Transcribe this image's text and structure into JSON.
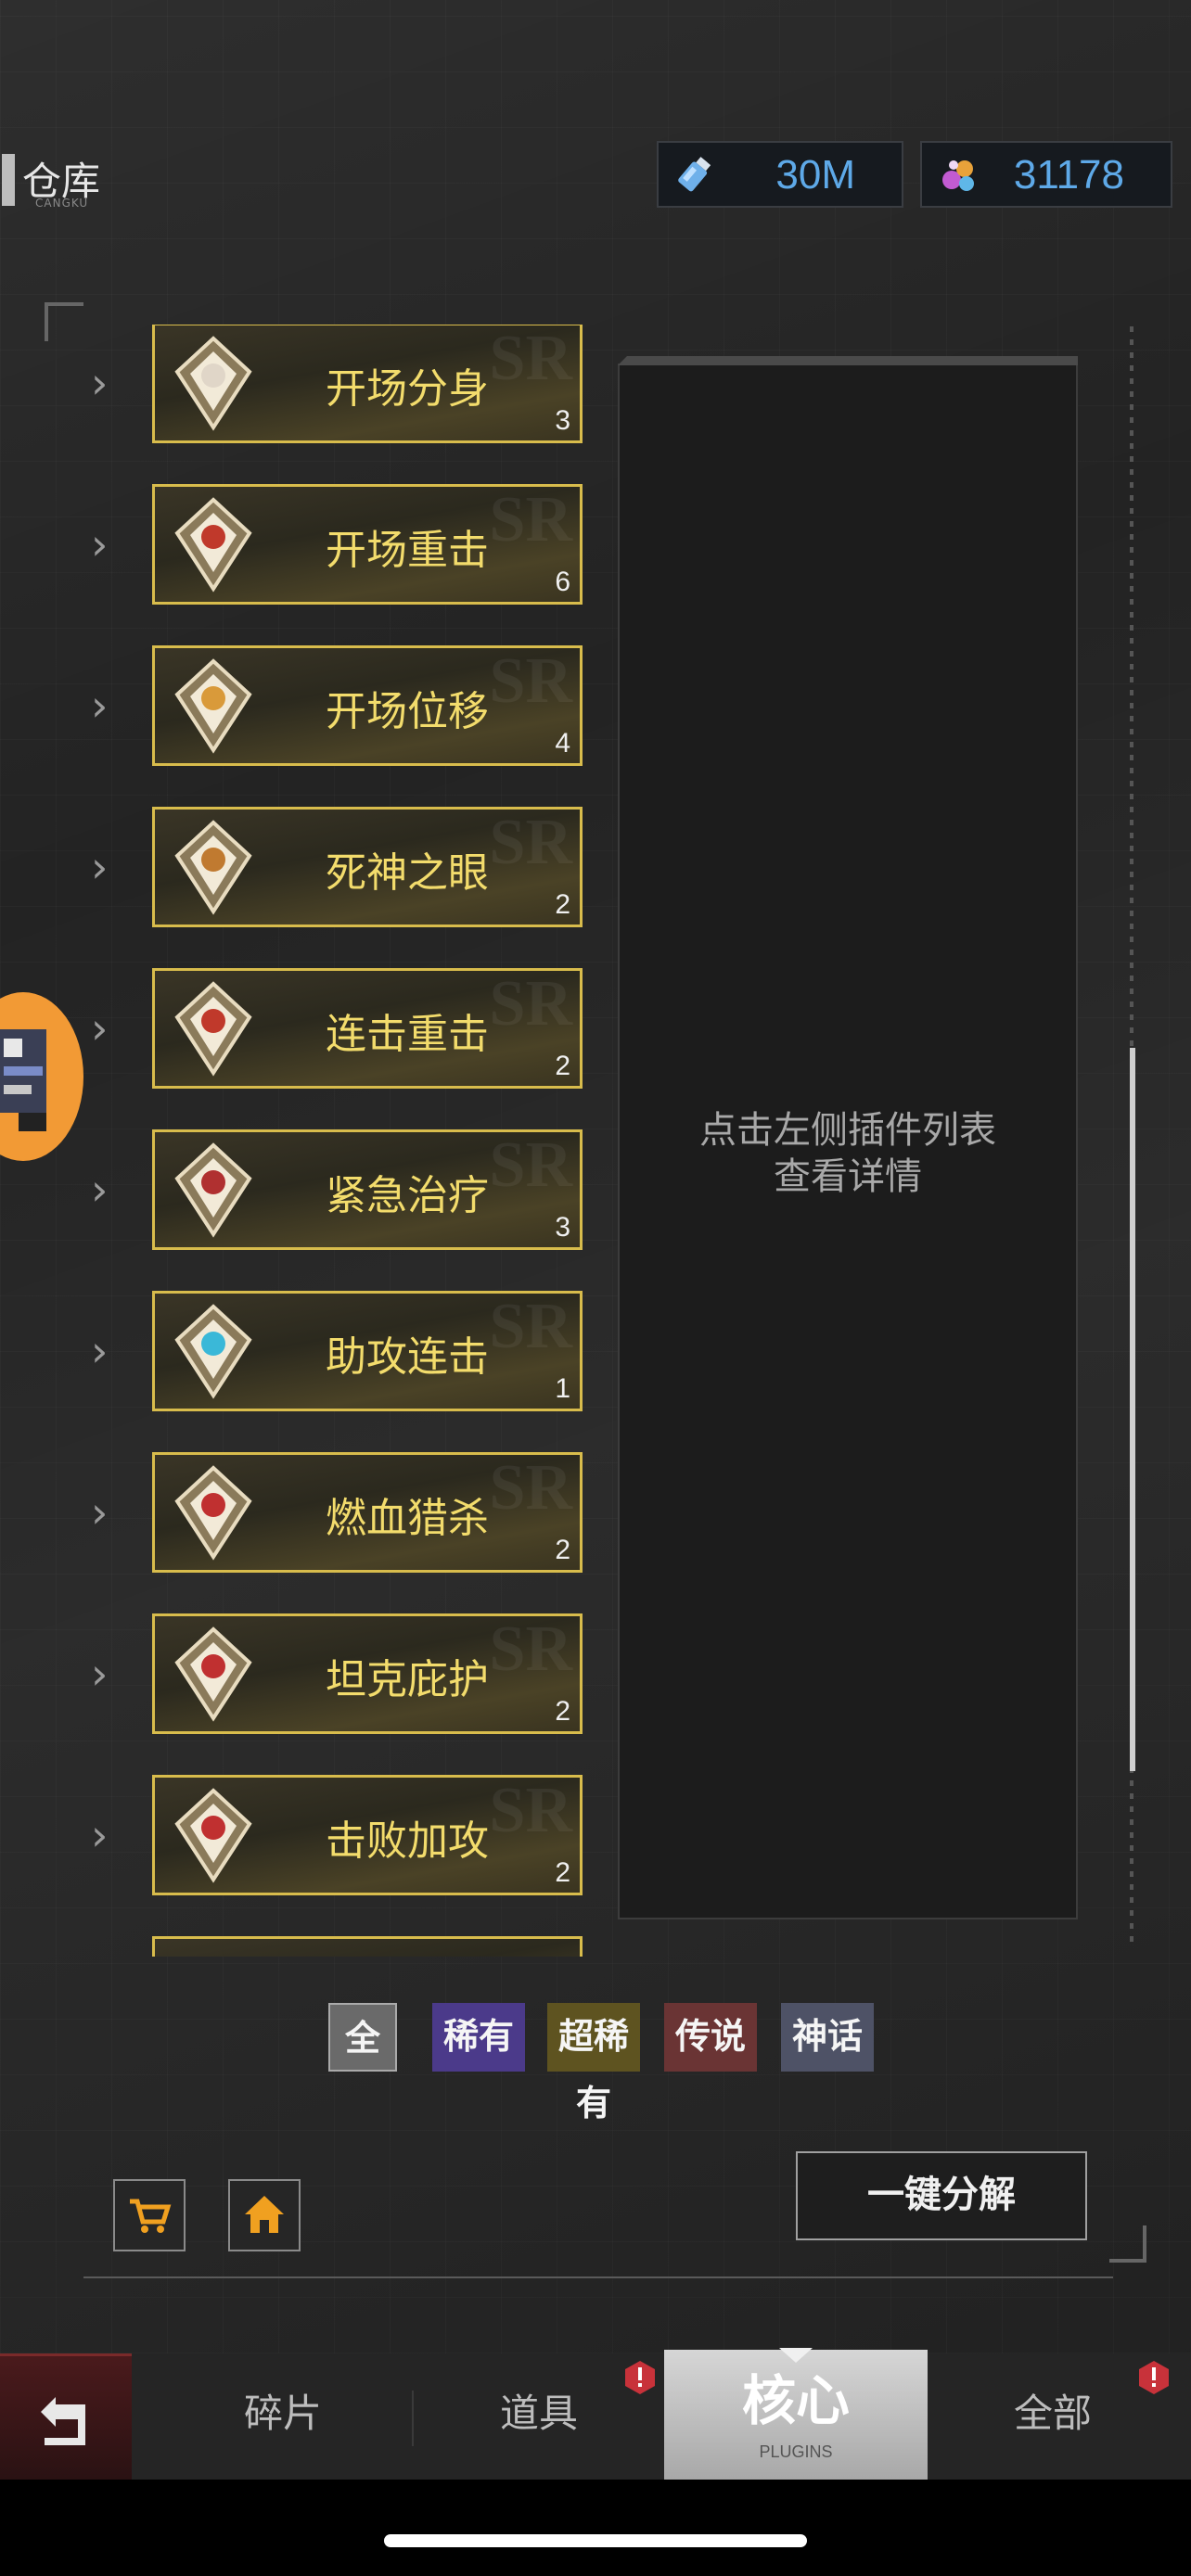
{
  "header": {
    "title": "仓库",
    "subtitle": "CANGKU",
    "currency_energy": "30M",
    "currency_gems": "31178",
    "energy_icon": "bottle-icon",
    "gems_icon": "crystal-cluster-icon"
  },
  "plugins": [
    {
      "name": "开场分身",
      "count": "3",
      "icon": "clone-icon"
    },
    {
      "name": "开场重击",
      "count": "6",
      "icon": "heavy-strike-icon"
    },
    {
      "name": "开场位移",
      "count": "4",
      "icon": "dash-icon"
    },
    {
      "name": "死神之眼",
      "count": "2",
      "icon": "reaper-eye-icon"
    },
    {
      "name": "连击重击",
      "count": "2",
      "icon": "combo-strike-icon"
    },
    {
      "name": "紧急治疗",
      "count": "3",
      "icon": "heal-icon"
    },
    {
      "name": "助攻连击",
      "count": "1",
      "icon": "assist-icon"
    },
    {
      "name": "燃血猎杀",
      "count": "2",
      "icon": "blood-hunt-icon"
    },
    {
      "name": "坦克庇护",
      "count": "2",
      "icon": "tank-shield-icon"
    },
    {
      "name": "击败加攻",
      "count": "2",
      "icon": "sword-icon"
    }
  ],
  "detail": {
    "line1": "点击左侧插件列表",
    "line2": "查看详情"
  },
  "filters": [
    {
      "label": "全",
      "color": "#6a6a6a"
    },
    {
      "label": "稀有",
      "color": "#4b3a8a"
    },
    {
      "label": "超稀有",
      "color": "#5e5320"
    },
    {
      "label": "传说",
      "color": "#6a3434"
    },
    {
      "label": "神话",
      "color": "#4e5266"
    }
  ],
  "actions": {
    "decompose_label": "一键分解",
    "shop_icon": "cart-icon",
    "home_icon": "home-icon"
  },
  "tabs": {
    "fragments": "碎片",
    "items": "道具",
    "core": "核心",
    "core_sub": "PLUGINS",
    "all": "全部"
  },
  "colors": {
    "gold": "#d8bc4c",
    "currency_text": "#5ea9e8",
    "alert": "#c8323a"
  }
}
